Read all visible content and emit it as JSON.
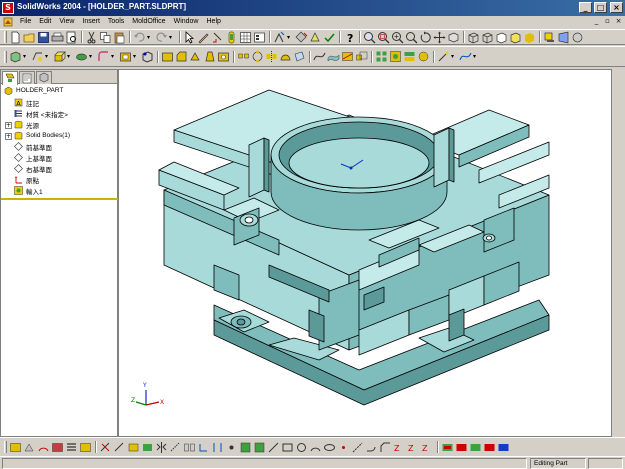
{
  "window": {
    "title": "SolidWorks 2004 - [HOLDER_PART.SLDPRT]",
    "app_icon_letter": "S",
    "minimize_label": "_",
    "maximize_label": "□",
    "close_label": "×"
  },
  "menubar": {
    "items": [
      "File",
      "Edit",
      "View",
      "Insert",
      "Tools",
      "MoldOffice",
      "Window",
      "Help"
    ],
    "mdi_minimize": "_",
    "mdi_restore": "▫",
    "mdi_close": "×"
  },
  "feature_tree": {
    "items": [
      {
        "label": "HOLDER_PART",
        "icon": "part-icon"
      },
      {
        "label": "註記",
        "icon": "annotations-icon"
      },
      {
        "label": "材質 <未指定>",
        "icon": "material-icon"
      },
      {
        "label": "光源",
        "icon": "lighting-icon"
      },
      {
        "label": "Solid Bodies(1)",
        "icon": "solid-bodies-icon"
      },
      {
        "label": "前基準面",
        "icon": "plane-icon"
      },
      {
        "label": "上基準面",
        "icon": "plane-icon"
      },
      {
        "label": "右基準面",
        "icon": "plane-icon"
      },
      {
        "label": "原點",
        "icon": "origin-icon"
      },
      {
        "label": "輸入1",
        "icon": "import-icon"
      }
    ],
    "expander_symbol": "+"
  },
  "triad": {
    "x": "X",
    "y": "Y",
    "z": "Z"
  },
  "statusbar": {
    "message": "",
    "mode": "Editing Part"
  },
  "colors": {
    "model_fill": "#a8dada",
    "model_shade": "#7fbcbc",
    "model_dark": "#5c9a9a",
    "model_edge": "#000000",
    "titlebar": "#0a246a"
  }
}
